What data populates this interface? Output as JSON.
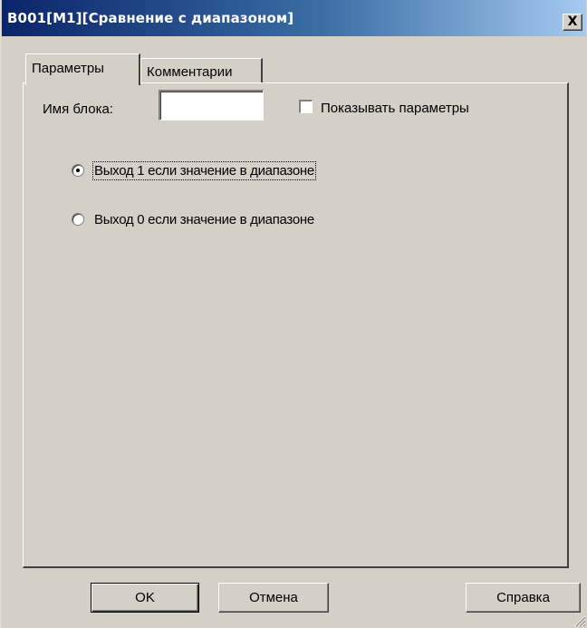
{
  "window": {
    "title": "B001[M1][Сравнение с диапазоном]",
    "close_label": "X"
  },
  "tabs": [
    {
      "label": "Параметры",
      "active": true
    },
    {
      "label": "Комментарии",
      "active": false
    }
  ],
  "params": {
    "block_name_label": "Имя блока:",
    "block_name_value": "",
    "show_params_label": "Показывать параметры",
    "show_params_checked": false,
    "radio_options": [
      {
        "label": "Выход 1 если значение в диапазоне",
        "selected": true
      },
      {
        "label": "Выход 0 если значение в диапазоне",
        "selected": false
      }
    ]
  },
  "buttons": {
    "ok": "OK",
    "cancel": "Отмена",
    "help": "Справка"
  },
  "icons": {
    "close": "close-icon",
    "resize": "resize-grip-icon"
  },
  "colors": {
    "title_start": "#0a246a",
    "title_end": "#a6caf0",
    "face": "#d4d0c8"
  }
}
